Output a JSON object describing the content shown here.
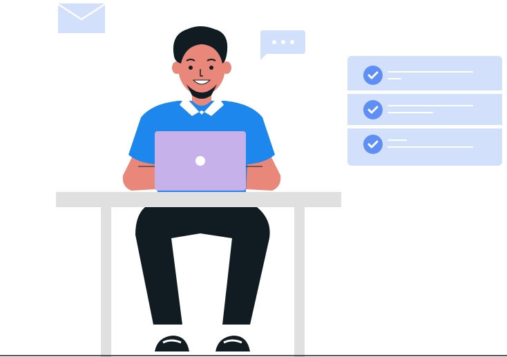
{
  "scene": {
    "description_items": {
      "envelope_icon": "envelope-icon",
      "chat_bubble_icon": "chat-bubble-icon",
      "check_icon": "checkmark-icon"
    },
    "colors": {
      "background": "#ffffff",
      "skin": "#e9877a",
      "hair": "#111c22",
      "shirt": "#1e87ee",
      "collar": "#ffffff",
      "laptop": "#c6b1ea",
      "pants": "#111c22",
      "desk": "#e0e0e0",
      "light_blue": "#d2e0fc",
      "check_badge": "#5f8ef5",
      "floor_line": "#111c22"
    },
    "checklist": {
      "items": [
        {
          "checked": true
        },
        {
          "checked": true
        },
        {
          "checked": true
        }
      ]
    }
  }
}
